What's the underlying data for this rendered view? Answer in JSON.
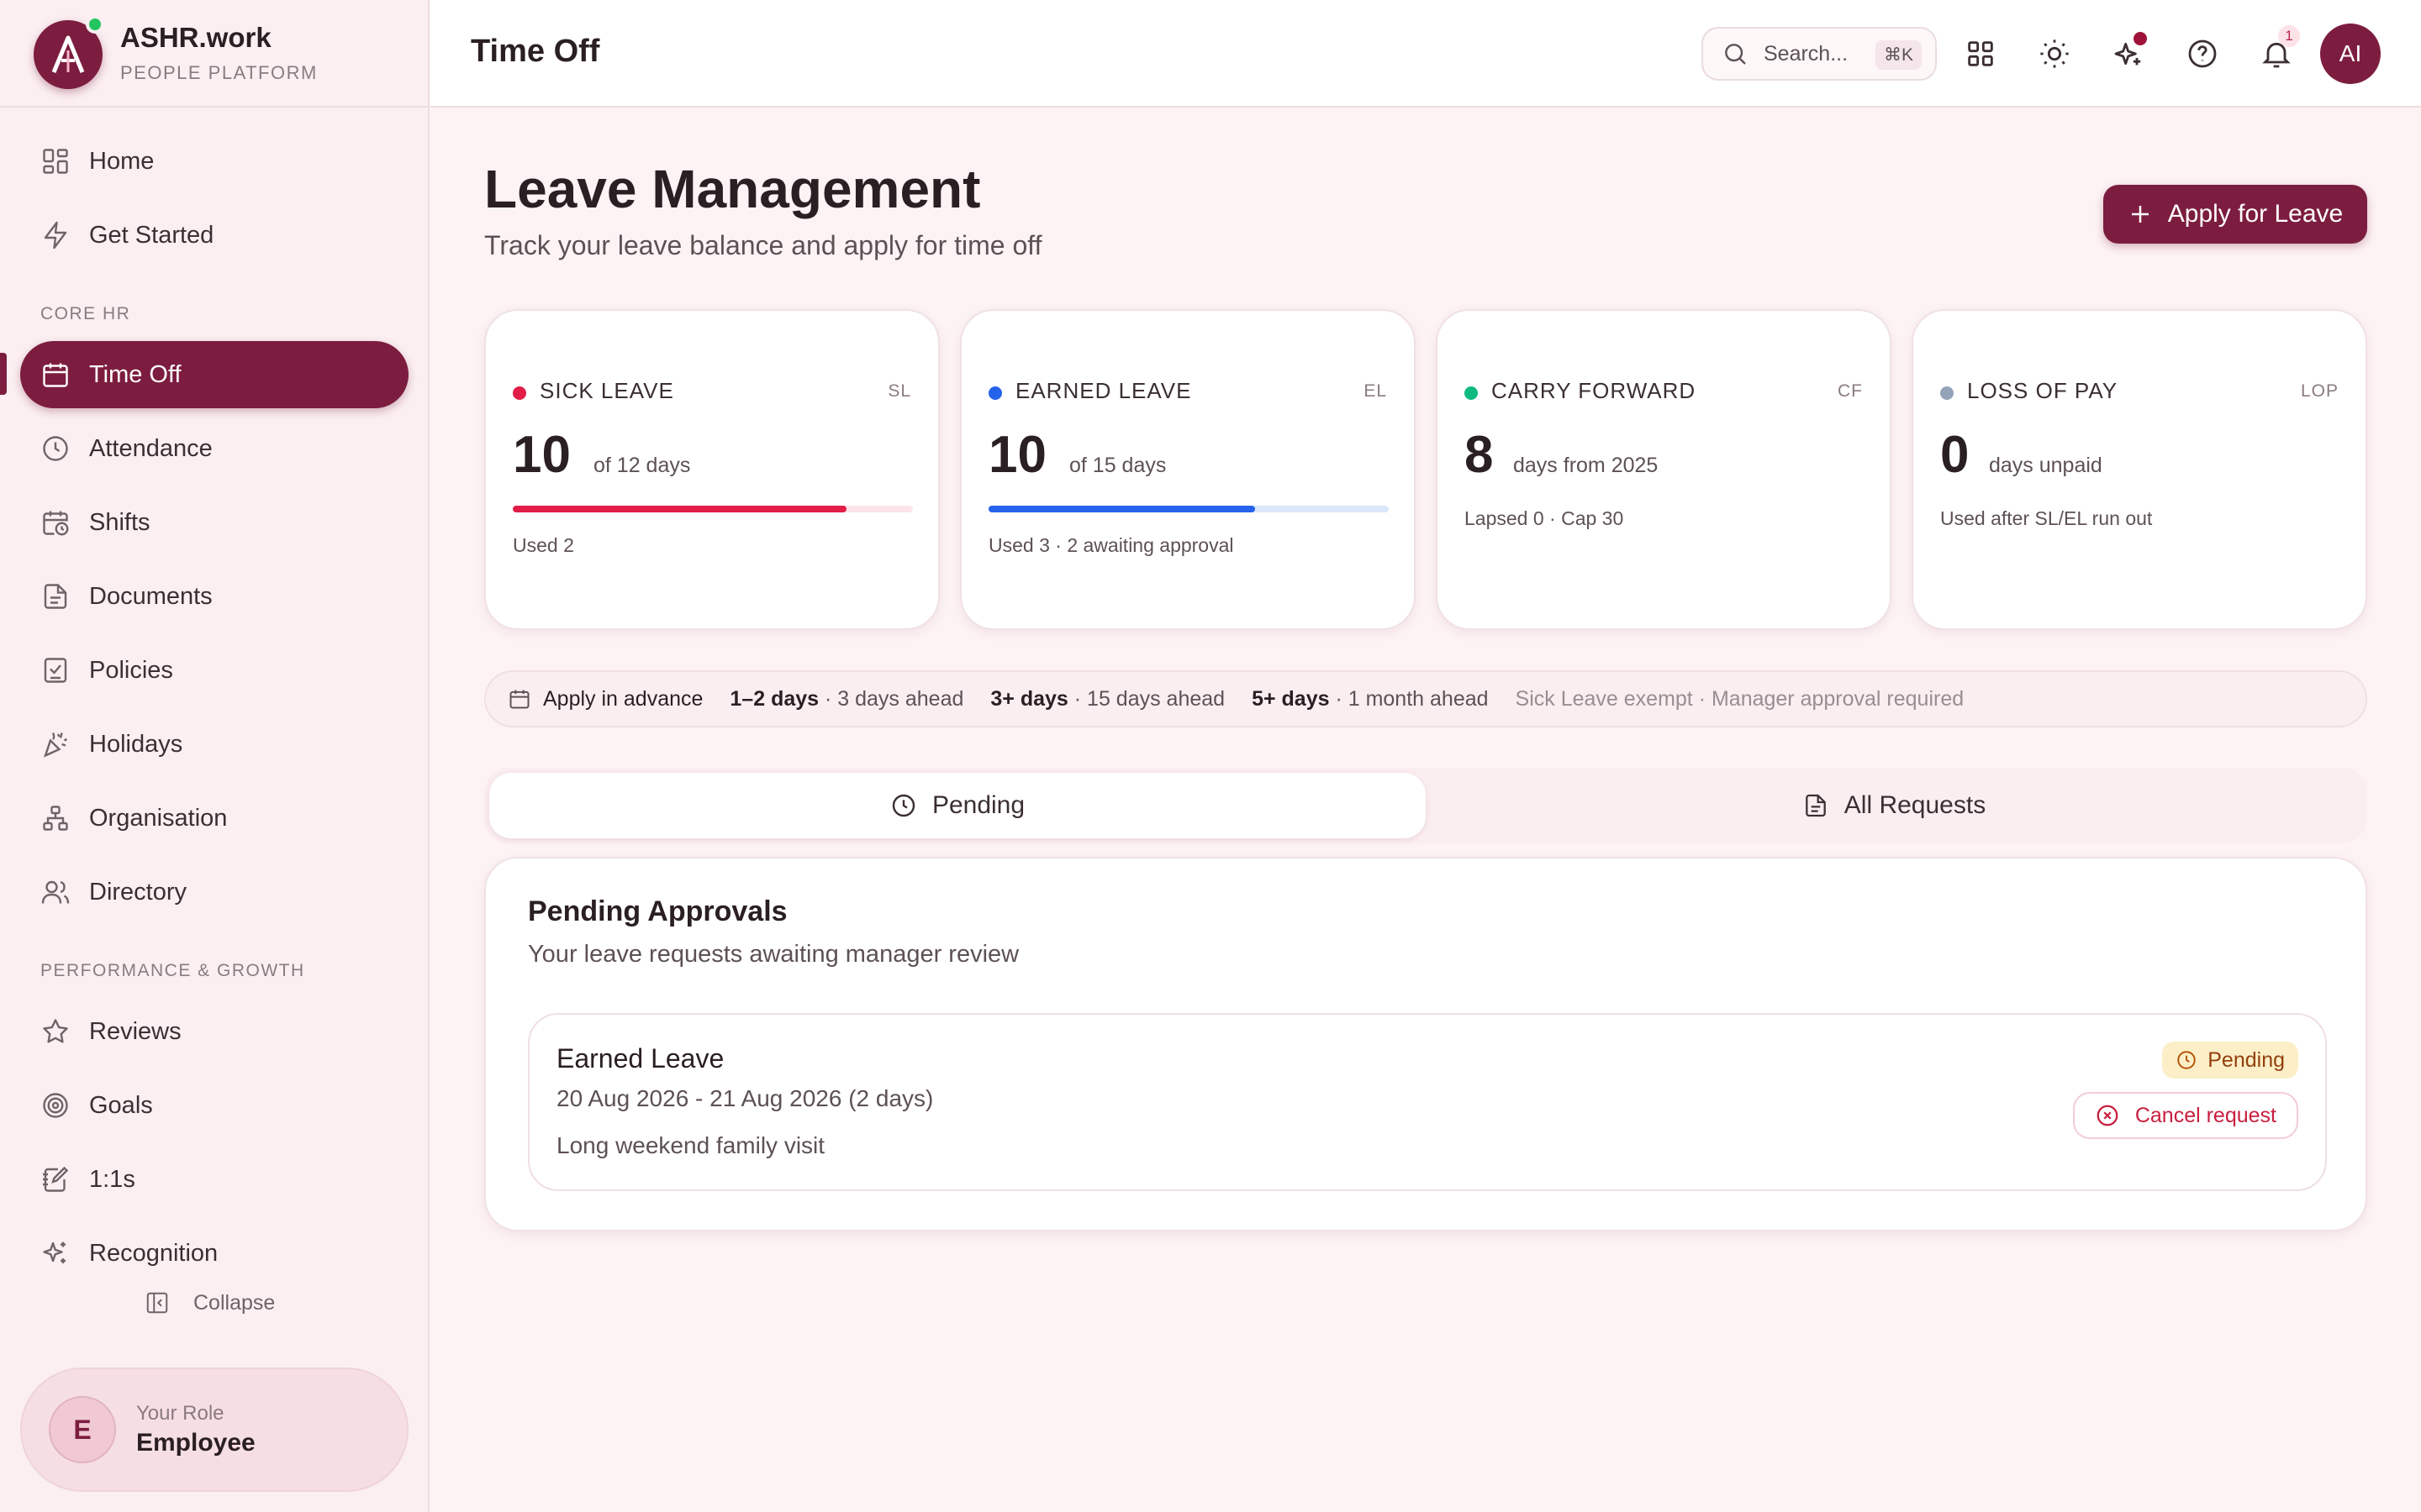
{
  "brand": {
    "name": "ASHR.work",
    "subtitle": "PEOPLE PLATFORM"
  },
  "sidebar": {
    "items": [
      {
        "label": "Home",
        "icon": "grid-icon"
      },
      {
        "label": "Get Started",
        "icon": "lightning-icon"
      }
    ],
    "core_hr_label": "CORE HR",
    "core_hr_items": [
      {
        "label": "Time Off",
        "icon": "calendar-icon",
        "active": true
      },
      {
        "label": "Attendance",
        "icon": "clock-icon"
      },
      {
        "label": "Shifts",
        "icon": "calendar-clock-icon"
      },
      {
        "label": "Documents",
        "icon": "document-icon"
      },
      {
        "label": "Policies",
        "icon": "checklist-icon"
      },
      {
        "label": "Holidays",
        "icon": "party-popper-icon"
      },
      {
        "label": "Organisation",
        "icon": "org-chart-icon"
      },
      {
        "label": "Directory",
        "icon": "users-icon"
      }
    ],
    "perf_label": "PERFORMANCE & GROWTH",
    "perf_items": [
      {
        "label": "Reviews",
        "icon": "star-icon"
      },
      {
        "label": "Goals",
        "icon": "target-icon"
      },
      {
        "label": "1:1s",
        "icon": "notebook-pen-icon"
      },
      {
        "label": "Recognition",
        "icon": "sparkles-icon"
      }
    ],
    "collapse_label": "Collapse",
    "role": {
      "initial": "E",
      "label": "Your Role",
      "value": "Employee"
    }
  },
  "header": {
    "title": "Time Off",
    "search_placeholder": "Search...",
    "search_shortcut": "⌘K",
    "notification_count": "1",
    "user_initials": "AI"
  },
  "main": {
    "title": "Leave Management",
    "subtitle": "Track your leave balance and apply for time off",
    "apply_button": "Apply for Leave"
  },
  "balances": [
    {
      "title": "SICK LEAVE",
      "code": "SL",
      "value": "10",
      "unit": "of 12 days",
      "note": "Used 2",
      "color": "#e11d48",
      "track": "#fde4ea",
      "progress": 0.833
    },
    {
      "title": "EARNED LEAVE",
      "code": "EL",
      "value": "10",
      "unit": "of 15 days",
      "note": "Used 3 · 2 awaiting approval",
      "color": "#2563eb",
      "track": "#dbe8fb",
      "progress": 0.667
    },
    {
      "title": "CARRY FORWARD",
      "code": "CF",
      "value": "8",
      "unit": "days from 2025",
      "note": "Lapsed 0 · Cap 30",
      "color": "#10b981"
    },
    {
      "title": "LOSS OF PAY",
      "code": "LOP",
      "value": "0",
      "unit": "days unpaid",
      "note": "Used after SL/EL run out",
      "color": "#94a3b8"
    }
  ],
  "policy": {
    "label": "Apply in advance",
    "rules": [
      {
        "bold": "1–2 days",
        "text": " · 3 days ahead"
      },
      {
        "bold": "3+ days",
        "text": " · 15 days ahead"
      },
      {
        "bold": "5+ days",
        "text": " · 1 month ahead"
      }
    ],
    "note": "Sick Leave exempt · Manager approval required"
  },
  "tabs": [
    {
      "label": "Pending",
      "icon": "clock-icon",
      "selected": true
    },
    {
      "label": "All Requests",
      "icon": "document-icon",
      "selected": false
    }
  ],
  "pending": {
    "title": "Pending Approvals",
    "description": "Your leave requests awaiting manager review",
    "requests": [
      {
        "type": "Earned Leave",
        "dates": "20 Aug 2026 - 21 Aug 2026 (2 days)",
        "reason": "Long weekend family visit",
        "status": "Pending",
        "cancel_label": "Cancel request"
      }
    ]
  }
}
